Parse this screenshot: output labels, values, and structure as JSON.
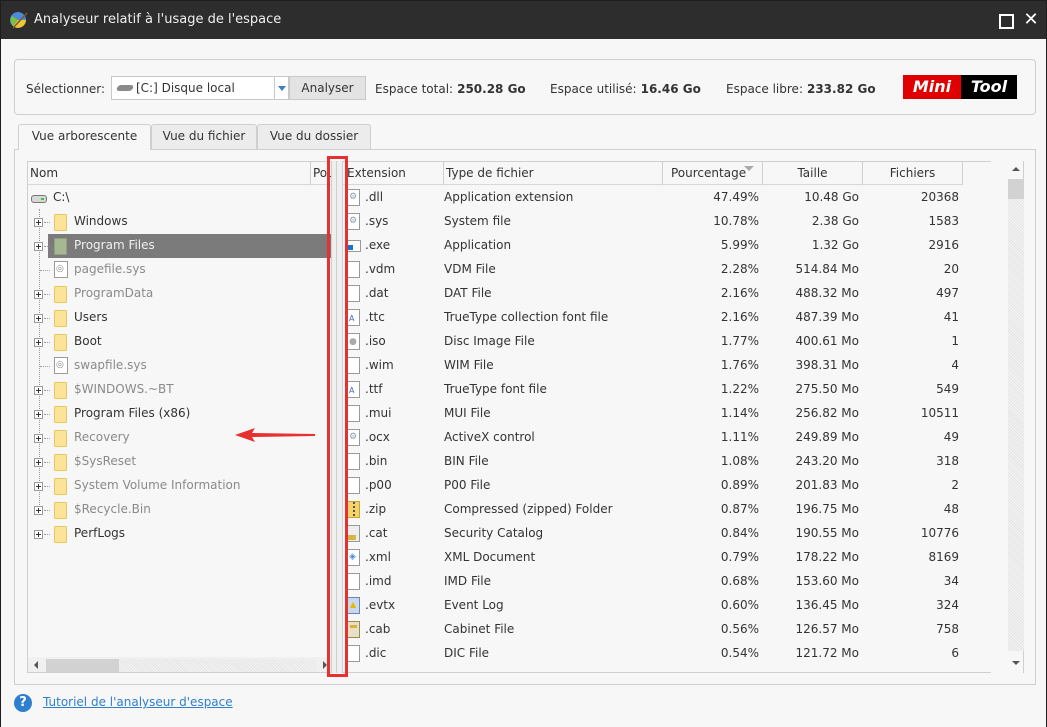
{
  "window": {
    "title": "Analyseur relatif à l'usage de l'espace",
    "maximize_icon": "maximize-icon",
    "close_glyph": "✕"
  },
  "toolbar": {
    "select_label": "Sélectionner:",
    "drive_value": "[C:] Disque local",
    "analyze_label": "Analyser",
    "total_label": "Espace total:",
    "total_value": "250.28 Go",
    "used_label": "Espace utilisé:",
    "used_value": "16.46 Go",
    "free_label": "Espace libre:",
    "free_value": "233.82 Go",
    "logo_left": "Mini",
    "logo_right": "Tool"
  },
  "tabs": [
    {
      "label": "Vue arborescente",
      "active": true
    },
    {
      "label": "Vue du fichier",
      "active": false
    },
    {
      "label": "Vue du dossier",
      "active": false
    }
  ],
  "tree": {
    "columns": {
      "name": "Nom",
      "percent": "Pou"
    },
    "root": "C:\\",
    "items": [
      {
        "name": "Windows",
        "kind": "folder",
        "state": "normal"
      },
      {
        "name": "Program Files",
        "kind": "folder",
        "state": "selected"
      },
      {
        "name": "pagefile.sys",
        "kind": "file",
        "state": "dim"
      },
      {
        "name": "ProgramData",
        "kind": "folder",
        "state": "dim"
      },
      {
        "name": "Users",
        "kind": "folder",
        "state": "normal"
      },
      {
        "name": "Boot",
        "kind": "folder",
        "state": "normal"
      },
      {
        "name": "swapfile.sys",
        "kind": "file",
        "state": "dim"
      },
      {
        "name": "$WINDOWS.~BT",
        "kind": "folder",
        "state": "dim"
      },
      {
        "name": "Program Files (x86)",
        "kind": "folder",
        "state": "normal"
      },
      {
        "name": "Recovery",
        "kind": "folder",
        "state": "dim"
      },
      {
        "name": "$SysReset",
        "kind": "folder",
        "state": "dim"
      },
      {
        "name": "System Volume Information",
        "kind": "folder",
        "state": "dim"
      },
      {
        "name": "$Recycle.Bin",
        "kind": "folder",
        "state": "dim"
      },
      {
        "name": "PerfLogs",
        "kind": "folder",
        "state": "normal"
      }
    ]
  },
  "table": {
    "columns": {
      "extension": "Extension",
      "type": "Type de fichier",
      "percent": "Pourcentage",
      "size": "Taille",
      "files": "Fichiers"
    },
    "sorted_by": "Pourcentage",
    "rows": [
      {
        "icon": "gear",
        "ext": ".dll",
        "type": "Application extension",
        "pct": "47.49%",
        "size": "10.48 Go",
        "files": "20368"
      },
      {
        "icon": "gear",
        "ext": ".sys",
        "type": "System file",
        "pct": "10.78%",
        "size": "2.38 Go",
        "files": "1583"
      },
      {
        "icon": "exe",
        "ext": ".exe",
        "type": "Application",
        "pct": "5.99%",
        "size": "1.32 Go",
        "files": "2916"
      },
      {
        "icon": "blank",
        "ext": ".vdm",
        "type": "VDM File",
        "pct": "2.28%",
        "size": "514.84 Mo",
        "files": "20"
      },
      {
        "icon": "blank",
        "ext": ".dat",
        "type": "DAT File",
        "pct": "2.16%",
        "size": "488.32 Mo",
        "files": "497"
      },
      {
        "icon": "font",
        "ext": ".ttc",
        "type": "TrueType collection font file",
        "pct": "2.16%",
        "size": "487.39 Mo",
        "files": "41"
      },
      {
        "icon": "disc",
        "ext": ".iso",
        "type": "Disc Image File",
        "pct": "1.77%",
        "size": "400.61 Mo",
        "files": "1"
      },
      {
        "icon": "blank",
        "ext": ".wim",
        "type": "WIM File",
        "pct": "1.76%",
        "size": "398.31 Mo",
        "files": "4"
      },
      {
        "icon": "font",
        "ext": ".ttf",
        "type": "TrueType font file",
        "pct": "1.22%",
        "size": "275.50 Mo",
        "files": "549"
      },
      {
        "icon": "blank",
        "ext": ".mui",
        "type": "MUI File",
        "pct": "1.14%",
        "size": "256.82 Mo",
        "files": "10511"
      },
      {
        "icon": "gear",
        "ext": ".ocx",
        "type": "ActiveX control",
        "pct": "1.11%",
        "size": "249.89 Mo",
        "files": "49"
      },
      {
        "icon": "blank",
        "ext": ".bin",
        "type": "BIN File",
        "pct": "1.08%",
        "size": "243.20 Mo",
        "files": "318"
      },
      {
        "icon": "blank",
        "ext": ".p00",
        "type": "P00 File",
        "pct": "0.89%",
        "size": "201.83 Mo",
        "files": "2"
      },
      {
        "icon": "zip",
        "ext": ".zip",
        "type": "Compressed (zipped) Folder",
        "pct": "0.87%",
        "size": "196.75 Mo",
        "files": "48"
      },
      {
        "icon": "cat",
        "ext": ".cat",
        "type": "Security Catalog",
        "pct": "0.84%",
        "size": "190.55 Mo",
        "files": "10776"
      },
      {
        "icon": "xml",
        "ext": ".xml",
        "type": "XML Document",
        "pct": "0.79%",
        "size": "178.22 Mo",
        "files": "8169"
      },
      {
        "icon": "blank",
        "ext": ".imd",
        "type": "IMD File",
        "pct": "0.68%",
        "size": "153.60 Mo",
        "files": "34"
      },
      {
        "icon": "evtx",
        "ext": ".evtx",
        "type": "Event Log",
        "pct": "0.60%",
        "size": "136.45 Mo",
        "files": "324"
      },
      {
        "icon": "cab",
        "ext": ".cab",
        "type": "Cabinet File",
        "pct": "0.56%",
        "size": "126.57 Mo",
        "files": "758"
      },
      {
        "icon": "blank",
        "ext": ".dic",
        "type": "DIC File",
        "pct": "0.54%",
        "size": "121.72 Mo",
        "files": "6"
      }
    ]
  },
  "footer": {
    "help_glyph": "?",
    "link": "Tutoriel de l'analyseur d'espace"
  },
  "annotation": {
    "highlight_color": "#e83030"
  }
}
